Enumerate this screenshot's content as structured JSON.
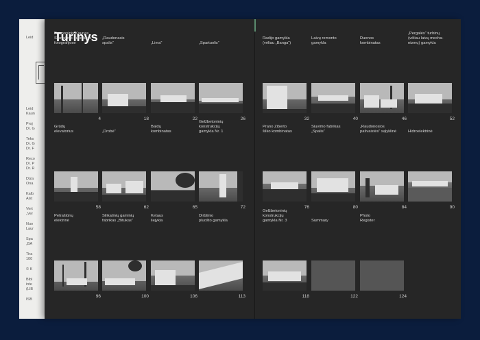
{
  "left_page_fragments": [
    "Leid",
    "Leid",
    "Kaun",
    "Proj",
    "Dr. G",
    "Teks",
    "Dr. G",
    "Dr. F",
    "Reco",
    "Dr. P",
    "Dr. R",
    "Diza",
    "Ona",
    "Kalb",
    "Aist",
    "Vert",
    "„Ver",
    "Nuo",
    "Laur",
    "Spa",
    "„BA",
    "Tira",
    "100",
    "© K",
    "Bibl",
    "inte",
    "(LIB",
    "ISB"
  ],
  "toc": {
    "title": "Turinys",
    "entries": [
      {
        "caption": "Pramoninis Kaunas\nStanislovo Lukošiaus\nfotografijose",
        "page": "4"
      },
      {
        "caption": "„Raudonasis\nspalis“",
        "page": "18"
      },
      {
        "caption": "„Lima“",
        "page": "22"
      },
      {
        "caption": "„Spartuolis“",
        "page": "26"
      },
      {
        "caption": "Grūdų\nelevatorius",
        "page": "58"
      },
      {
        "caption": "„Drobė“",
        "page": "62"
      },
      {
        "caption": "Baldų\nkombinatas",
        "page": "65"
      },
      {
        "caption": "Gelžbetoninių\nkonstrukcijų\ngamykla Nr. 1",
        "page": "72"
      },
      {
        "caption": "Petrašiūnų\nelektrinė",
        "page": "96"
      },
      {
        "caption": "Silikatinių gaminių\nfabrikas „Bitukas“",
        "page": "100"
      },
      {
        "caption": "Ketaus\nliejykla",
        "page": "106"
      },
      {
        "caption": "Dirbtinio\npluošto gamykla",
        "page": "113"
      },
      {
        "caption": "Radijo gamykla\n(vėliau „Banga“)",
        "page": "32"
      },
      {
        "caption": "Laivų remonto\ngamykla",
        "page": "40"
      },
      {
        "caption": "Duonos\nkombinatas",
        "page": "46"
      },
      {
        "caption": "„Pergalės“ turbinų\n(vėliau laivų mecha-\nnizmų) gamykla",
        "page": "52"
      },
      {
        "caption": "Prano Ziberto\nšilko kombinatas",
        "page": "76"
      },
      {
        "caption": "Siuvimo fabrikas\n„Spalis“",
        "page": "80"
      },
      {
        "caption": "„Raudonosios\npašvaistės“ sąlyklinė",
        "page": "84"
      },
      {
        "caption": "Hidroelektrinė",
        "page": "90"
      },
      {
        "caption": "Gelžbetoninių\nkonstrukcijų\ngamykla Nr. 3",
        "page": "118"
      },
      {
        "caption": "Summary",
        "page": "122"
      },
      {
        "caption": "Photo\nRegister",
        "page": "124"
      }
    ]
  }
}
